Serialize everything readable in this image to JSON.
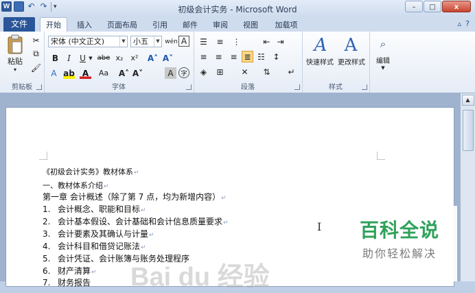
{
  "window": {
    "title": "初级会计实务  -  Microsoft Word",
    "controls": {
      "minimize": "–",
      "maximize": "□",
      "close": "x"
    }
  },
  "quick_access": {
    "word_logo": "W",
    "more": "▾"
  },
  "tabs": {
    "file": "文件",
    "items": [
      "开始",
      "插入",
      "页面布局",
      "引用",
      "邮件",
      "审阅",
      "视图",
      "加载项"
    ],
    "active": "开始"
  },
  "ribbon": {
    "clipboard": {
      "label": "剪贴板",
      "paste": "粘贴"
    },
    "font": {
      "label": "字体",
      "font_name": "宋体 (中文正文)",
      "font_size": "小五",
      "wen_button": "wén",
      "char_border": "A",
      "bold": "B",
      "italic": "I",
      "underline": "U",
      "strike": "abe",
      "subscript": "x₂",
      "superscript": "x²",
      "grow": "A˄",
      "shrink": "A˅",
      "change_case": "Aa",
      "char_shade": "A",
      "enclose": "字"
    },
    "paragraph": {
      "label": "段落"
    },
    "styles": {
      "label": "样式",
      "quick_styles": "快速样式",
      "change_styles": "更改样式"
    },
    "editing": {
      "label": "编辑"
    }
  },
  "document": {
    "lines": [
      {
        "num": "",
        "text": "《初级会计实务》教材体系"
      },
      {
        "num": "",
        "text": "一、教材体系介绍"
      },
      {
        "num": "",
        "text": "第一章 会计概述（除了第 7 点，均为新增内容）"
      },
      {
        "num": "1.",
        "text": "会计概念、职能和目标"
      },
      {
        "num": "2.",
        "text": "会计基本假设、会计基础和会计信息质量要求"
      },
      {
        "num": "3.",
        "text": "会计要素及其确认与计量"
      },
      {
        "num": "4.",
        "text": "会计科目和借贷记账法"
      },
      {
        "num": "5.",
        "text": "会计凭证、会计账簿与账务处理程序"
      },
      {
        "num": "6.",
        "text": "财产清算"
      },
      {
        "num": "7.",
        "text": "财务报告"
      }
    ]
  },
  "overlay": {
    "baike_title": "百科全说",
    "baike_subtitle": "助你轻松解决",
    "watermark": "Bai du 经验"
  },
  "colors": {
    "file_tab": "#2a5699",
    "baike_green": "#2fa25a"
  }
}
